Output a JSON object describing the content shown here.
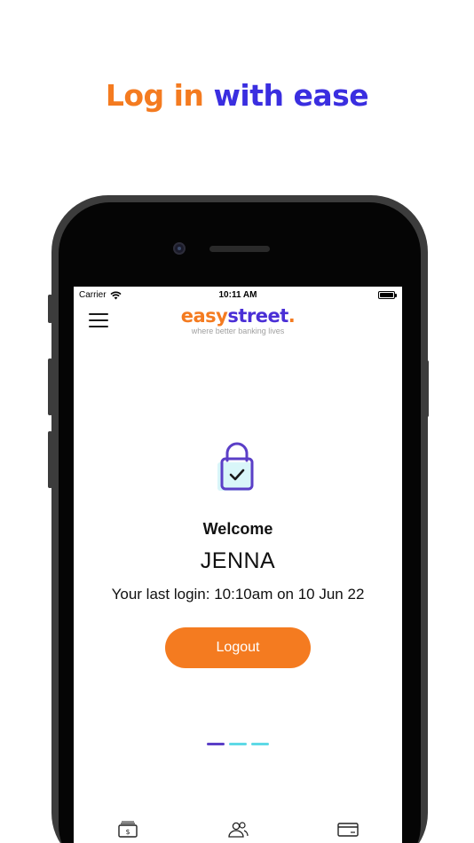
{
  "headline": {
    "part1": "Log in",
    "part2": "with ease"
  },
  "status_bar": {
    "carrier": "Carrier",
    "time": "10:11 AM"
  },
  "app": {
    "logo_easy": "easy",
    "logo_street": "street",
    "logo_dot": ".",
    "tagline": "where better banking lives"
  },
  "login": {
    "welcome": "Welcome",
    "username": "JENNA",
    "last_login": "Your last login: 10:10am on 10 Jun 22",
    "logout_label": "Logout"
  },
  "pager": {
    "pages": 3,
    "active": 0
  },
  "tabbar": {
    "icons": [
      "cash-icon",
      "users-icon",
      "card-icon"
    ]
  },
  "colors": {
    "orange": "#f47b20",
    "blue": "#3a2ee0",
    "purple": "#5b3fc7",
    "cyan": "#5ed9e6"
  }
}
